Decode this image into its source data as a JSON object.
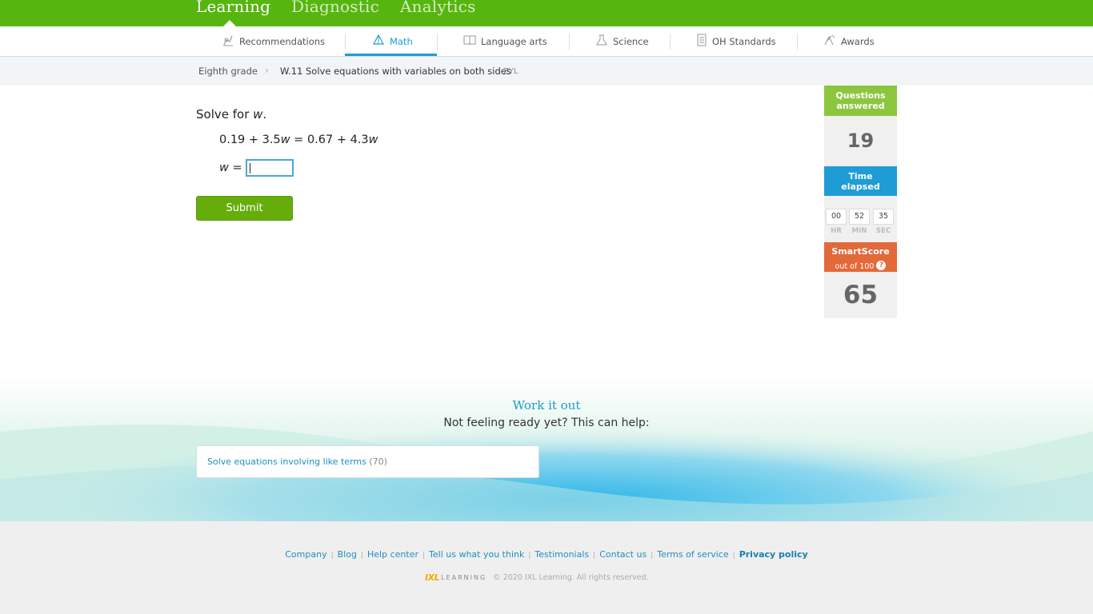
{
  "top_nav": {
    "tabs": [
      {
        "label": "Learning"
      },
      {
        "label": "Diagnostic"
      },
      {
        "label": "Analytics"
      }
    ]
  },
  "subject_nav": {
    "items": [
      {
        "label": "Recommendations",
        "icon": "recommendations-icon"
      },
      {
        "label": "Math",
        "icon": "math-icon"
      },
      {
        "label": "Language arts",
        "icon": "book-icon"
      },
      {
        "label": "Science",
        "icon": "flask-icon"
      },
      {
        "label": "OH Standards",
        "icon": "standards-icon"
      },
      {
        "label": "Awards",
        "icon": "awards-icon"
      }
    ],
    "active": "Math"
  },
  "breadcrumb": {
    "grade": "Eighth grade",
    "skill": "W.11 Solve equations with variables on both sides",
    "code": "ZYL"
  },
  "question": {
    "prompt_prefix": "Solve for ",
    "prompt_var": "w",
    "prompt_suffix": ".",
    "equation": {
      "a": "0.19 + 3.5",
      "v1": "w",
      "b": " = 0.67 + 4.3",
      "v2": "w"
    },
    "answer_var": "w",
    "answer_eq": " =",
    "answer_value": "",
    "submit_label": "Submit"
  },
  "stats": {
    "questions_label_1": "Questions",
    "questions_label_2": "answered",
    "questions_answered": "19",
    "time_label_1": "Time",
    "time_label_2": "elapsed",
    "hr": "00",
    "min": "52",
    "sec": "35",
    "hr_label": "HR",
    "min_label": "MIN",
    "sec_label": "SEC",
    "smartscore_label": "SmartScore",
    "smartscore_sub": "out of 100",
    "help": "?",
    "smartscore": "65"
  },
  "work_it_out": {
    "title": "Work it out",
    "subtitle": "Not feeling ready yet? This can help:",
    "link_label": "Solve equations involving like terms",
    "link_count": "(70)"
  },
  "footer": {
    "links": [
      "Company",
      "Blog",
      "Help center",
      "Tell us what you think",
      "Testimonials",
      "Contact us",
      "Terms of service",
      "Privacy policy"
    ],
    "logo_text": "IXL",
    "logo_sub": "LEARNING",
    "copyright": "© 2020 IXL Learning. All rights reserved."
  },
  "colors": {
    "brand_green": "#56b50e",
    "accent_blue": "#1f9cd6",
    "smartscore_orange": "#e2693a"
  }
}
